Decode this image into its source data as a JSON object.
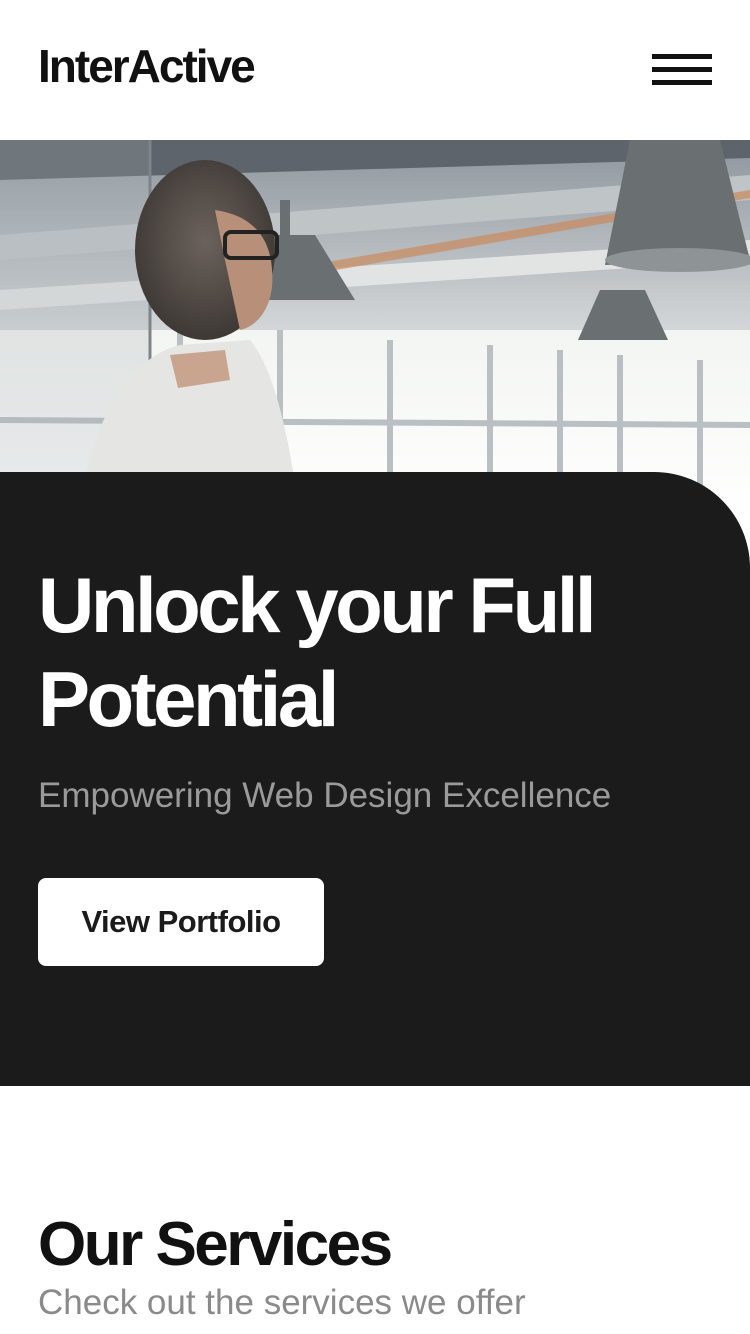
{
  "header": {
    "logo": "InterActive",
    "menu_icon": "hamburger-menu-icon"
  },
  "hero": {
    "image_description_icon": "office-photo",
    "title_line1": "Unlock your Full",
    "title_line2": "Potential",
    "subtitle": "Empowering Web Design Excellence",
    "cta_label": "View Portfolio"
  },
  "services": {
    "title": "Our Services",
    "subtitle": "Check out the services we offer"
  },
  "colors": {
    "background": "#ffffff",
    "hero_panel": "#1b1b1c",
    "text_dark": "#111111",
    "text_muted": "#9a9a9a"
  }
}
